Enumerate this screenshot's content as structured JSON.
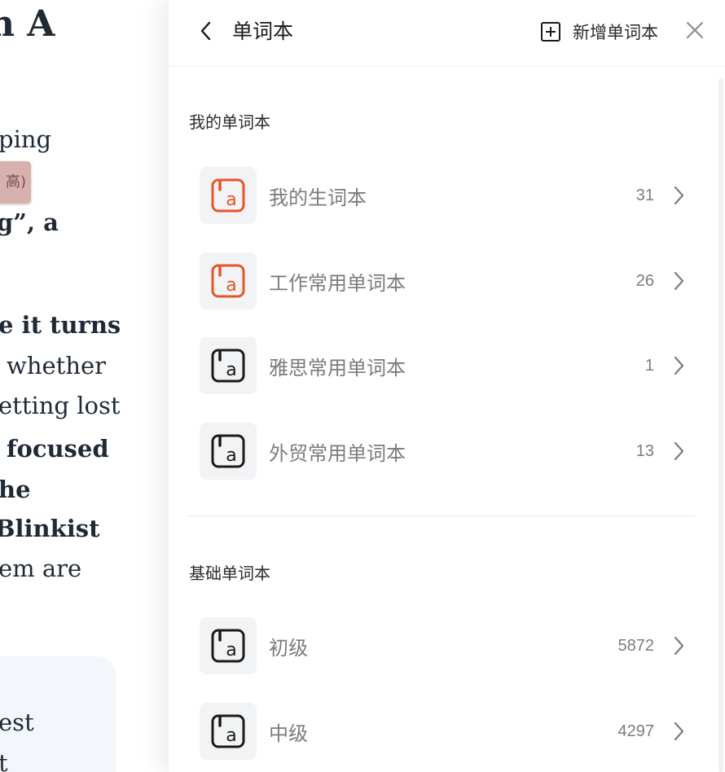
{
  "article": {
    "heading": "n A",
    "lines": [
      {
        "text": "ping",
        "bold": false
      },
      {
        "text": "g”, a",
        "bold": false
      },
      {
        "text": "e it turns",
        "bold": true
      },
      {
        "text": "whether",
        "bold": false
      },
      {
        "text": "etting lost",
        "bold": false
      },
      {
        "text": "focused",
        "bold": true
      },
      {
        "text": "he",
        "bold": true
      },
      {
        "text": "Blinkist",
        "bold": true
      },
      {
        "text": "em are",
        "bold": false
      },
      {
        "text": "est",
        "bold": false
      },
      {
        "text": "t",
        "bold": false
      }
    ],
    "tag_text": "高)"
  },
  "panel": {
    "title": "单词本",
    "add_label": "新增单词本",
    "icons": {
      "back": "chevron-left-icon",
      "add": "plus-square-icon",
      "close": "close-icon",
      "row": "vocabulary-book-icon",
      "row_arrow": "chevron-right-icon"
    },
    "colors": {
      "accent": "#e8552a",
      "icon_default": "#1a1a1a",
      "icon_bg": "#f2f3f5",
      "muted_text": "#7c7c7c"
    },
    "sections": [
      {
        "title": "我的单词本",
        "items": [
          {
            "name": "我的生词本",
            "count": "31",
            "accent": true
          },
          {
            "name": "工作常用单词本",
            "count": "26",
            "accent": true
          },
          {
            "name": "雅思常用单词本",
            "count": "1",
            "accent": false
          },
          {
            "name": "外贸常用单词本",
            "count": "13",
            "accent": false
          }
        ]
      },
      {
        "title": "基础单词本",
        "items": [
          {
            "name": "初级",
            "count": "5872",
            "accent": false
          },
          {
            "name": "中级",
            "count": "4297",
            "accent": false
          }
        ]
      }
    ]
  }
}
